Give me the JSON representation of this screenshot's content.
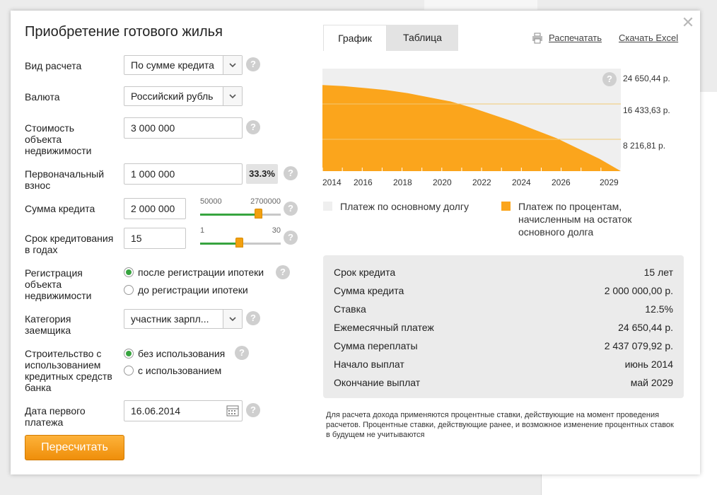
{
  "title": "Приобретение готового жилья",
  "close_symbol": "✕",
  "form": {
    "calc_type": {
      "label": "Вид расчета",
      "value": "По сумме кредита"
    },
    "currency": {
      "label": "Валюта",
      "value": "Российский рубль"
    },
    "property_cost": {
      "label": "Стоимость объекта недвижимости",
      "value": "3 000 000"
    },
    "down_payment": {
      "label": "Первоначальный взнос",
      "value": "1 000 000",
      "percent": "33.3%"
    },
    "loan_amount": {
      "label": "Сумма кредита",
      "value": "2 000 000",
      "slider_min": "50000",
      "slider_max": "2700000",
      "slider_level": 0.72
    },
    "loan_term": {
      "label": "Срок кредитования в годах",
      "value": "15",
      "slider_min": "1",
      "slider_max": "30",
      "slider_level": 0.48
    },
    "registration": {
      "label": "Регистрация объекта недвижимости",
      "options": [
        "после регистрации ипотеки",
        "до регистрации ипотеки"
      ],
      "selected": 0
    },
    "category": {
      "label": "Категория заемщика",
      "value": "участник зарпл..."
    },
    "construction": {
      "label": "Строительство с использованием кредитных средств банка",
      "options": [
        "без использования",
        "с использованием"
      ],
      "selected": 0
    },
    "first_payment_date": {
      "label": "Дата первого платежа",
      "value": "16.06.2014"
    },
    "recalc_button": "Пересчитать",
    "help_symbol": "?"
  },
  "tabs": [
    {
      "label": "График",
      "active": true
    },
    {
      "label": "Таблица",
      "active": false
    }
  ],
  "links": {
    "print": "Распечатать",
    "excel": "Скачать Excel"
  },
  "chart_data": {
    "type": "area",
    "x_ticks": [
      "2014",
      "2016",
      "2018",
      "2020",
      "2022",
      "2024",
      "2026",
      "2029"
    ],
    "y_ticks": [
      "24 650,44 р.",
      "16 433,63 р.",
      "8 216,81 р."
    ],
    "series": [
      {
        "name": "Платеж по основному долгу",
        "color": "#efefef"
      },
      {
        "name": "Платеж по процентам, начисленным на остаток основного долга",
        "color": "#fba51c"
      }
    ],
    "interest_share": [
      0.84,
      0.83,
      0.81,
      0.79,
      0.76,
      0.72,
      0.68,
      0.62,
      0.55,
      0.48,
      0.4,
      0.32,
      0.22,
      0.12,
      0.0
    ],
    "ylim": [
      0,
      24650.44
    ]
  },
  "summary": [
    {
      "k": "Срок кредита",
      "v": "15 лет"
    },
    {
      "k": "Сумма кредита",
      "v": "2 000 000,00 р."
    },
    {
      "k": "Ставка",
      "v": "12.5%"
    },
    {
      "k": "Ежемесячный платеж",
      "v": "24 650,44 р."
    },
    {
      "k": "Сумма переплаты",
      "v": "2 437 079,92 р."
    },
    {
      "k": "Начало выплат",
      "v": "июнь 2014"
    },
    {
      "k": "Окончание выплат",
      "v": "май 2029"
    }
  ],
  "note": "Для расчета дохода применяются процентные ставки, действующие на момент проведения расчетов. Процентные ставки, действующие ранее, и возможное изменение процентных ставок в будущем не учитываются",
  "colors": {
    "accent": "#fba51c",
    "green": "#37a43f",
    "button": "#f5a020"
  }
}
